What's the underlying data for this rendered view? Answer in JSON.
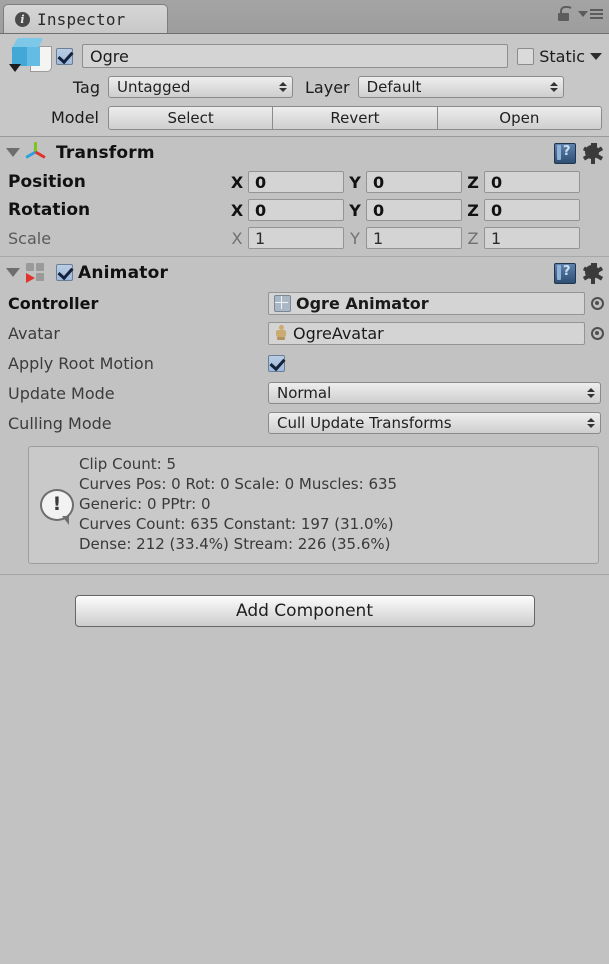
{
  "window": {
    "tab_label": "Inspector",
    "info_icon": "info-icon",
    "lock_icon": "lock-open-icon",
    "menu_icon": "hamburger-menu-icon"
  },
  "gameobject": {
    "icon": "prefab-model-icon",
    "enabled": true,
    "name": "Ogre",
    "static_label": "Static",
    "static_checked": false,
    "tag_label": "Tag",
    "tag_value": "Untagged",
    "layer_label": "Layer",
    "layer_value": "Default",
    "model_label": "Model",
    "model_buttons": [
      "Select",
      "Revert",
      "Open"
    ]
  },
  "transform": {
    "title": "Transform",
    "icon": "transform-axis-icon",
    "expanded": true,
    "rows": [
      {
        "label": "Position",
        "x": "0",
        "y": "0",
        "z": "0",
        "bold": true
      },
      {
        "label": "Rotation",
        "x": "0",
        "y": "0",
        "z": "0",
        "bold": true
      },
      {
        "label": "Scale",
        "x": "1",
        "y": "1",
        "z": "1",
        "bold": false
      }
    ],
    "axis_labels": [
      "X",
      "Y",
      "Z"
    ]
  },
  "animator": {
    "title": "Animator",
    "icon": "animator-icon",
    "enabled": true,
    "expanded": true,
    "controller_label": "Controller",
    "controller_value": "Ogre Animator",
    "controller_icon": "animator-controller-icon",
    "avatar_label": "Avatar",
    "avatar_value": "OgreAvatar",
    "avatar_icon": "avatar-humanoid-icon",
    "apply_root_motion_label": "Apply Root Motion",
    "apply_root_motion_checked": true,
    "update_mode_label": "Update Mode",
    "update_mode_value": "Normal",
    "culling_mode_label": "Culling Mode",
    "culling_mode_value": "Cull Update Transforms",
    "info": {
      "icon": "info-bubble-icon",
      "lines": [
        "Clip Count: 5",
        "Curves Pos: 0 Rot: 0 Scale: 0 Muscles: 635",
        "Generic: 0 PPtr: 0",
        "Curves Count: 635 Constant: 197 (31.0%)",
        "Dense: 212 (33.4%) Stream: 226 (35.6%)"
      ]
    }
  },
  "footer": {
    "add_component_label": "Add Component"
  },
  "colors": {
    "panel_bg": "#c2c2c2",
    "tabbar_bg": "#a0a0a0",
    "field_bg": "#d4d4d4",
    "accent_blue": "#42a8d6",
    "play_red": "#e0342a",
    "axis_green": "#7bc618"
  }
}
